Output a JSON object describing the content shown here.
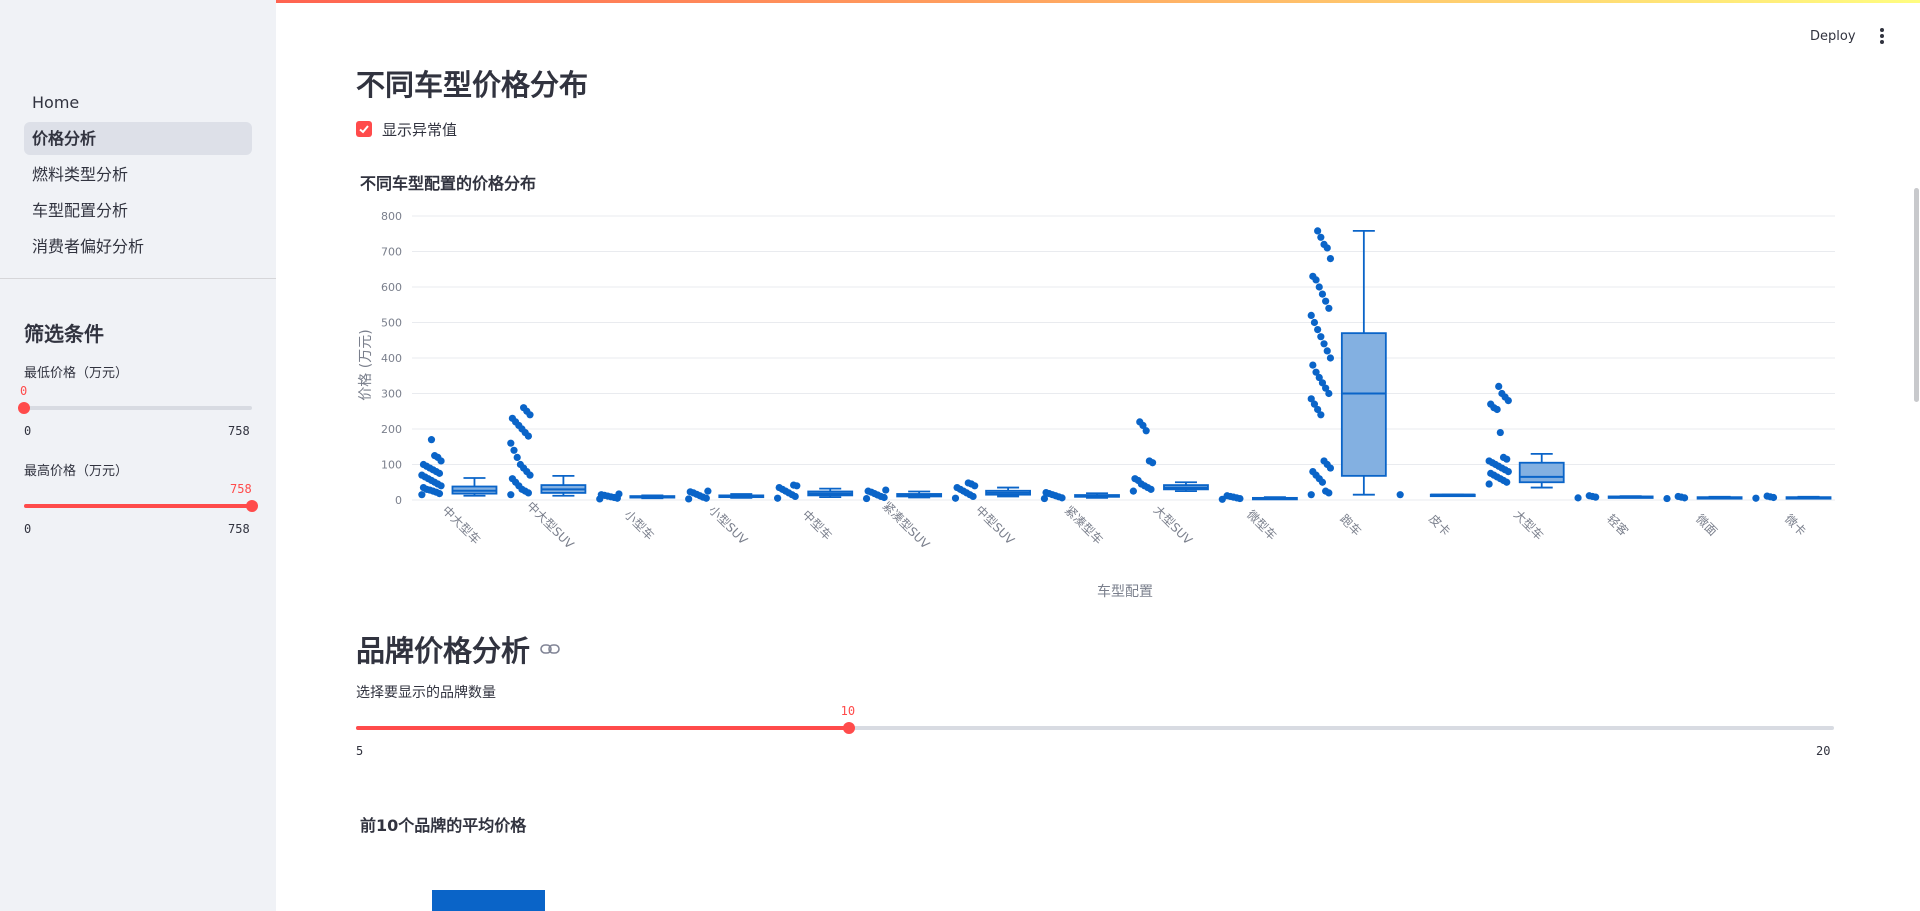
{
  "sidebar": {
    "nav": [
      "Home",
      "价格分析",
      "燃料类型分析",
      "车型配置分析",
      "消费者偏好分析"
    ],
    "active_index": 1,
    "filter_title": "筛选条件",
    "min_price": {
      "label": "最低价格（万元）",
      "value": 0,
      "min": 0,
      "max": 758,
      "value_text": "0",
      "min_text": "0",
      "max_text": "758"
    },
    "max_price": {
      "label": "最高价格（万元）",
      "value": 758,
      "min": 0,
      "max": 758,
      "value_text": "758",
      "min_text": "0",
      "max_text": "758"
    }
  },
  "header": {
    "deploy_label": "Deploy"
  },
  "main": {
    "title": "不同车型价格分布",
    "outlier_checkbox": {
      "label": "显示异常值",
      "checked": true
    },
    "box_chart_title": "不同车型配置的价格分布",
    "brand_section_title": "品牌价格分析",
    "brand_slider": {
      "label": "选择要显示的品牌数量",
      "value": 10,
      "min": 5,
      "max": 20,
      "value_text": "10",
      "min_text": "5",
      "max_text": "20"
    },
    "brand_chart_title": "前10个品牌的平均价格"
  },
  "colors": {
    "accent": "#ff4b4b",
    "box_fill": "#83b0e1",
    "box_line": "#0a64c8"
  },
  "chart_data": [
    {
      "type": "box",
      "title": "不同车型配置的价格分布",
      "xlabel": "车型配置",
      "ylabel": "价格 (万元)",
      "ylim": [
        0,
        800
      ],
      "yticks": [
        0,
        100,
        200,
        300,
        400,
        500,
        600,
        700,
        800
      ],
      "grid": true,
      "categories": [
        "中大型车",
        "中大型SUV",
        "小型车",
        "小型SUV",
        "中型车",
        "紧凑型SUV",
        "中型SUV",
        "紧凑型车",
        "大型SUV",
        "微型车",
        "跑车",
        "皮卡",
        "大型车",
        "轻客",
        "微面",
        "微卡"
      ],
      "boxes": [
        {
          "min": 12,
          "q1": 18,
          "median": 26,
          "q3": 38,
          "max": 62,
          "points": [
            15,
            18,
            22,
            25,
            28,
            30,
            35,
            40,
            45,
            50,
            55,
            60,
            65,
            70,
            75,
            80,
            85,
            90,
            95,
            100,
            110,
            120,
            125,
            170
          ]
        },
        {
          "min": 12,
          "q1": 20,
          "median": 30,
          "q3": 42,
          "max": 68,
          "points": [
            15,
            20,
            25,
            30,
            40,
            50,
            60,
            70,
            80,
            90,
            100,
            120,
            140,
            160,
            180,
            190,
            200,
            210,
            220,
            230,
            240,
            250,
            260
          ]
        },
        {
          "min": 5,
          "q1": 7,
          "median": 9,
          "q3": 11,
          "max": 13,
          "points": [
            3,
            5,
            7,
            9,
            11,
            13,
            15,
            17
          ]
        },
        {
          "min": 6,
          "q1": 8,
          "median": 10,
          "q3": 13,
          "max": 17,
          "points": [
            3,
            5,
            8,
            12,
            16,
            20,
            23,
            25
          ]
        },
        {
          "min": 8,
          "q1": 13,
          "median": 18,
          "q3": 24,
          "max": 32,
          "points": [
            5,
            10,
            15,
            20,
            25,
            30,
            35,
            40,
            42
          ]
        },
        {
          "min": 7,
          "q1": 10,
          "median": 13,
          "q3": 17,
          "max": 24,
          "points": [
            4,
            7,
            10,
            14,
            18,
            22,
            25,
            28
          ]
        },
        {
          "min": 10,
          "q1": 15,
          "median": 20,
          "q3": 26,
          "max": 35,
          "points": [
            5,
            10,
            15,
            20,
            25,
            30,
            35,
            40,
            45,
            48
          ]
        },
        {
          "min": 6,
          "q1": 9,
          "median": 11,
          "q3": 14,
          "max": 19,
          "points": [
            4,
            6,
            9,
            12,
            15,
            18,
            21
          ]
        },
        {
          "min": 25,
          "q1": 30,
          "median": 35,
          "q3": 42,
          "max": 50,
          "points": [
            25,
            30,
            35,
            40,
            45,
            55,
            60,
            105,
            110,
            195,
            210,
            220
          ]
        },
        {
          "min": 3,
          "q1": 4,
          "median": 5,
          "q3": 6,
          "max": 8,
          "points": [
            2,
            4,
            6,
            8,
            10,
            12
          ]
        },
        {
          "min": 15,
          "q1": 68,
          "median": 300,
          "q3": 470,
          "max": 758,
          "points": [
            15,
            20,
            25,
            50,
            60,
            70,
            80,
            90,
            100,
            110,
            240,
            255,
            270,
            285,
            300,
            315,
            330,
            345,
            360,
            380,
            400,
            420,
            440,
            460,
            480,
            500,
            520,
            540,
            560,
            580,
            600,
            620,
            630,
            680,
            710,
            720,
            740,
            758
          ]
        },
        {
          "min": 15,
          "q1": 15,
          "median": 15,
          "q3": 15,
          "max": 15,
          "points": [
            15
          ]
        },
        {
          "min": 35,
          "q1": 50,
          "median": 65,
          "q3": 105,
          "max": 130,
          "points": [
            45,
            50,
            55,
            60,
            65,
            70,
            75,
            80,
            85,
            90,
            95,
            100,
            105,
            110,
            115,
            120,
            190,
            255,
            260,
            270,
            280,
            290,
            300,
            320
          ]
        },
        {
          "min": 7,
          "q1": 8,
          "median": 9,
          "q3": 10,
          "max": 11,
          "points": [
            6,
            8,
            10,
            12
          ]
        },
        {
          "min": 5,
          "q1": 6,
          "median": 7,
          "q3": 8,
          "max": 9,
          "points": [
            4,
            6,
            8,
            10
          ]
        },
        {
          "min": 6,
          "q1": 7,
          "median": 7,
          "q3": 8,
          "max": 9,
          "points": [
            5,
            7,
            9,
            11
          ]
        }
      ]
    },
    {
      "type": "bar",
      "title": "前10个品牌的平均价格"
    }
  ]
}
